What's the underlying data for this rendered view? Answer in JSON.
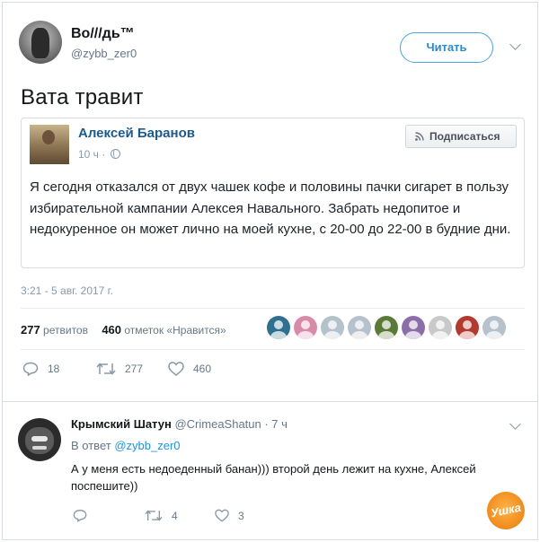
{
  "tweet": {
    "display_name": "Во///дь™",
    "handle": "@zybb_zer0",
    "follow_label": "Читать",
    "text": "Вата травит",
    "timestamp": "3:21 - 5 авг. 2017 г.",
    "retweets_count": "277",
    "retweets_label": "ретвитов",
    "likes_count": "460",
    "likes_label": "отметок «Нравится»",
    "liker_colors": [
      "#2f6f8f",
      "#d98aa8",
      "#b5c1cb",
      "#b5c1cb",
      "#5a7a3a",
      "#8c6fa8",
      "#c9c9c9",
      "#b23a2f",
      "#b5c1cb"
    ],
    "actions": {
      "replies": "18",
      "retweets": "277",
      "likes": "460"
    }
  },
  "quote": {
    "author": "Алексей Баранов",
    "time": "10 ч ·",
    "subscribe_label": "Подписаться",
    "body": "Я сегодня отказался от двух чашек кофе и половины пачки сигарет в пользу избирательной кампании Алексея Навального. Забрать недопитое и недокуренное он может лично на моей кухне, с 20-00 до 22-00 в будние дни."
  },
  "reply": {
    "author": "Крымский Шатун",
    "handle_time": "@CrimeaShatun · 7 ч",
    "in_reply_prefix": "В ответ",
    "in_reply_handle": "@zybb_zer0",
    "text": "А у меня есть недоеденный банан))) второй день лежит на кухне, Алексей поспешите))",
    "actions": {
      "replies": "",
      "retweets": "4",
      "likes": "3"
    }
  },
  "watermark": "Ушка",
  "colors": {
    "link": "#1b95e0",
    "follow_border": "#4aa3df",
    "muted": "#657786",
    "quote_name": "#1b5a8c"
  }
}
